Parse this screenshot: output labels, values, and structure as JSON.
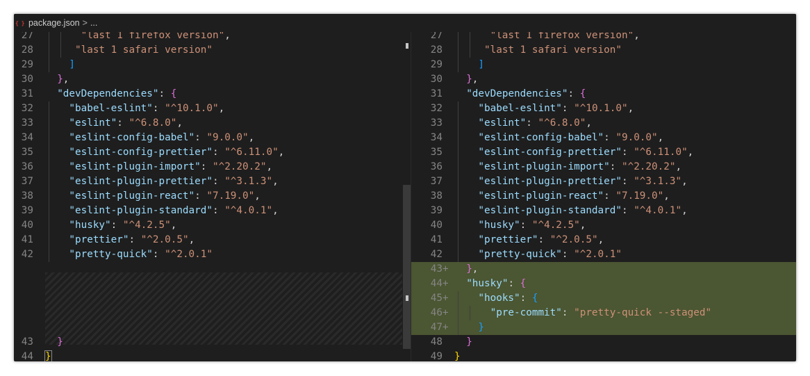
{
  "breadcrumb": {
    "icon_label": "{ }",
    "file": "package.json",
    "separator": ">",
    "trail": "..."
  },
  "colors": {
    "background": "#1e1e1e",
    "key": "#9cdcfe",
    "string": "#ce9178",
    "bracket_level1": "#da70d6",
    "bracket_level2": "#179fff",
    "bracket_level3": "#ffd700",
    "added_line": "#4b5632"
  },
  "left_pane": {
    "lines": [
      {
        "n": "27",
        "parts": [
          [
            "s",
            "\"last 1 firefox version\""
          ],
          [
            "p",
            ","
          ]
        ]
      },
      {
        "n": "28",
        "parts": [
          [
            "s",
            "\"last 1 safari version\""
          ]
        ]
      },
      {
        "n": "29",
        "parts": [
          [
            "b2",
            "]"
          ]
        ]
      },
      {
        "n": "30",
        "parts": [
          [
            "b1",
            "}"
          ],
          [
            "p",
            ","
          ]
        ]
      },
      {
        "n": "31",
        "parts": [
          [
            "k",
            "\"devDependencies\""
          ],
          [
            "p",
            ": "
          ],
          [
            "b1",
            "{"
          ]
        ]
      },
      {
        "n": "32",
        "parts": [
          [
            "k",
            "\"babel-eslint\""
          ],
          [
            "p",
            ": "
          ],
          [
            "s",
            "\"^10.1.0\""
          ],
          [
            "p",
            ","
          ]
        ]
      },
      {
        "n": "33",
        "parts": [
          [
            "k",
            "\"eslint\""
          ],
          [
            "p",
            ": "
          ],
          [
            "s",
            "\"^6.8.0\""
          ],
          [
            "p",
            ","
          ]
        ]
      },
      {
        "n": "34",
        "parts": [
          [
            "k",
            "\"eslint-config-babel\""
          ],
          [
            "p",
            ": "
          ],
          [
            "s",
            "\"9.0.0\""
          ],
          [
            "p",
            ","
          ]
        ]
      },
      {
        "n": "35",
        "parts": [
          [
            "k",
            "\"eslint-config-prettier\""
          ],
          [
            "p",
            ": "
          ],
          [
            "s",
            "\"^6.11.0\""
          ],
          [
            "p",
            ","
          ]
        ]
      },
      {
        "n": "36",
        "parts": [
          [
            "k",
            "\"eslint-plugin-import\""
          ],
          [
            "p",
            ": "
          ],
          [
            "s",
            "\"^2.20.2\""
          ],
          [
            "p",
            ","
          ]
        ]
      },
      {
        "n": "37",
        "parts": [
          [
            "k",
            "\"eslint-plugin-prettier\""
          ],
          [
            "p",
            ": "
          ],
          [
            "s",
            "\"^3.1.3\""
          ],
          [
            "p",
            ","
          ]
        ]
      },
      {
        "n": "38",
        "parts": [
          [
            "k",
            "\"eslint-plugin-react\""
          ],
          [
            "p",
            ": "
          ],
          [
            "s",
            "\"7.19.0\""
          ],
          [
            "p",
            ","
          ]
        ]
      },
      {
        "n": "39",
        "parts": [
          [
            "k",
            "\"eslint-plugin-standard\""
          ],
          [
            "p",
            ": "
          ],
          [
            "s",
            "\"^4.0.1\""
          ],
          [
            "p",
            ","
          ]
        ]
      },
      {
        "n": "40",
        "parts": [
          [
            "k",
            "\"husky\""
          ],
          [
            "p",
            ": "
          ],
          [
            "s",
            "\"^4.2.5\""
          ],
          [
            "p",
            ","
          ]
        ]
      },
      {
        "n": "41",
        "parts": [
          [
            "k",
            "\"prettier\""
          ],
          [
            "p",
            ": "
          ],
          [
            "s",
            "\"^2.0.5\""
          ],
          [
            "p",
            ","
          ]
        ]
      },
      {
        "n": "42",
        "parts": [
          [
            "k",
            "\"pretty-quick\""
          ],
          [
            "p",
            ": "
          ],
          [
            "s",
            "\"^2.0.1\""
          ]
        ]
      },
      {
        "n": "43",
        "parts": [
          [
            "b1",
            "}"
          ]
        ]
      },
      {
        "n": "44",
        "parts": [
          [
            "b3",
            "}"
          ]
        ]
      }
    ]
  },
  "right_pane": {
    "lines": [
      {
        "n": "27",
        "mark": "",
        "parts": [
          [
            "s",
            "\"last 1 firefox version\""
          ],
          [
            "p",
            ","
          ]
        ]
      },
      {
        "n": "28",
        "mark": "",
        "parts": [
          [
            "s",
            "\"last 1 safari version\""
          ]
        ]
      },
      {
        "n": "29",
        "mark": "",
        "parts": [
          [
            "b2",
            "]"
          ]
        ]
      },
      {
        "n": "30",
        "mark": "",
        "parts": [
          [
            "b1",
            "}"
          ],
          [
            "p",
            ","
          ]
        ]
      },
      {
        "n": "31",
        "mark": "",
        "parts": [
          [
            "k",
            "\"devDependencies\""
          ],
          [
            "p",
            ": "
          ],
          [
            "b1",
            "{"
          ]
        ]
      },
      {
        "n": "32",
        "mark": "",
        "parts": [
          [
            "k",
            "\"babel-eslint\""
          ],
          [
            "p",
            ": "
          ],
          [
            "s",
            "\"^10.1.0\""
          ],
          [
            "p",
            ","
          ]
        ]
      },
      {
        "n": "33",
        "mark": "",
        "parts": [
          [
            "k",
            "\"eslint\""
          ],
          [
            "p",
            ": "
          ],
          [
            "s",
            "\"^6.8.0\""
          ],
          [
            "p",
            ","
          ]
        ]
      },
      {
        "n": "34",
        "mark": "",
        "parts": [
          [
            "k",
            "\"eslint-config-babel\""
          ],
          [
            "p",
            ": "
          ],
          [
            "s",
            "\"9.0.0\""
          ],
          [
            "p",
            ","
          ]
        ]
      },
      {
        "n": "35",
        "mark": "",
        "parts": [
          [
            "k",
            "\"eslint-config-prettier\""
          ],
          [
            "p",
            ": "
          ],
          [
            "s",
            "\"^6.11.0\""
          ],
          [
            "p",
            ","
          ]
        ]
      },
      {
        "n": "36",
        "mark": "",
        "parts": [
          [
            "k",
            "\"eslint-plugin-import\""
          ],
          [
            "p",
            ": "
          ],
          [
            "s",
            "\"^2.20.2\""
          ],
          [
            "p",
            ","
          ]
        ]
      },
      {
        "n": "37",
        "mark": "",
        "parts": [
          [
            "k",
            "\"eslint-plugin-prettier\""
          ],
          [
            "p",
            ": "
          ],
          [
            "s",
            "\"^3.1.3\""
          ],
          [
            "p",
            ","
          ]
        ]
      },
      {
        "n": "38",
        "mark": "",
        "parts": [
          [
            "k",
            "\"eslint-plugin-react\""
          ],
          [
            "p",
            ": "
          ],
          [
            "s",
            "\"7.19.0\""
          ],
          [
            "p",
            ","
          ]
        ]
      },
      {
        "n": "39",
        "mark": "",
        "parts": [
          [
            "k",
            "\"eslint-plugin-standard\""
          ],
          [
            "p",
            ": "
          ],
          [
            "s",
            "\"^4.0.1\""
          ],
          [
            "p",
            ","
          ]
        ]
      },
      {
        "n": "40",
        "mark": "",
        "parts": [
          [
            "k",
            "\"husky\""
          ],
          [
            "p",
            ": "
          ],
          [
            "s",
            "\"^4.2.5\""
          ],
          [
            "p",
            ","
          ]
        ]
      },
      {
        "n": "41",
        "mark": "",
        "parts": [
          [
            "k",
            "\"prettier\""
          ],
          [
            "p",
            ": "
          ],
          [
            "s",
            "\"^2.0.5\""
          ],
          [
            "p",
            ","
          ]
        ]
      },
      {
        "n": "42",
        "mark": "",
        "parts": [
          [
            "k",
            "\"pretty-quick\""
          ],
          [
            "p",
            ": "
          ],
          [
            "s",
            "\"^2.0.1\""
          ]
        ]
      },
      {
        "n": "43",
        "mark": "+",
        "added": true,
        "parts": [
          [
            "b1",
            "}"
          ],
          [
            "p",
            ","
          ]
        ]
      },
      {
        "n": "44",
        "mark": "+",
        "added": true,
        "parts": [
          [
            "k",
            "\"husky\""
          ],
          [
            "p",
            ": "
          ],
          [
            "b1",
            "{"
          ]
        ]
      },
      {
        "n": "45",
        "mark": "+",
        "added": true,
        "parts": [
          [
            "k",
            "\"hooks\""
          ],
          [
            "p",
            ": "
          ],
          [
            "b2",
            "{"
          ]
        ]
      },
      {
        "n": "46",
        "mark": "+",
        "added": true,
        "parts": [
          [
            "k",
            "\"pre-commit\""
          ],
          [
            "p",
            ": "
          ],
          [
            "s",
            "\"pretty-quick --staged\""
          ]
        ]
      },
      {
        "n": "47",
        "mark": "+",
        "added": true,
        "parts": [
          [
            "b2",
            "}"
          ]
        ]
      },
      {
        "n": "48",
        "mark": "",
        "parts": [
          [
            "b1",
            "}"
          ]
        ]
      },
      {
        "n": "49",
        "mark": "",
        "parts": [
          [
            "b3",
            "}"
          ]
        ]
      }
    ]
  }
}
